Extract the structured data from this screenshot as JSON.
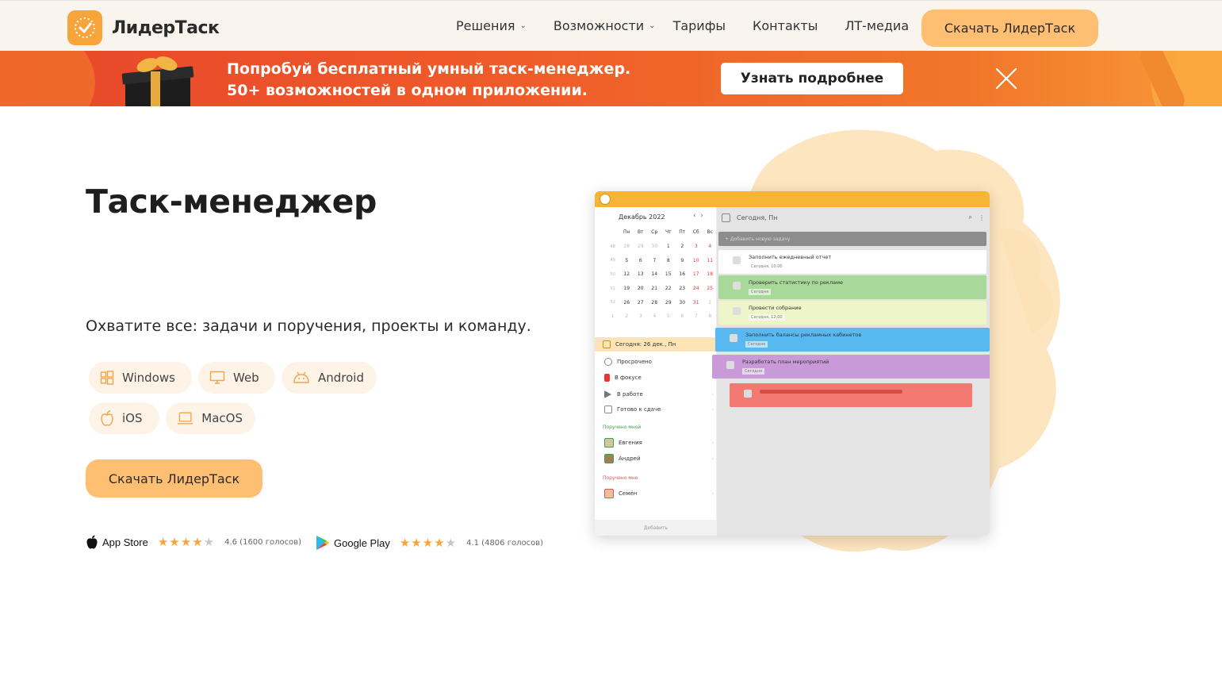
{
  "header": {
    "brand": "ЛидерТаск",
    "nav": [
      {
        "label": "Решения",
        "has_dropdown": true
      },
      {
        "label": "Возможности",
        "has_dropdown": true
      },
      {
        "label": "Тарифы",
        "has_dropdown": false
      },
      {
        "label": "Контакты",
        "has_dropdown": false
      },
      {
        "label": "ЛТ-медиа",
        "has_dropdown": false
      }
    ],
    "cta_label": "Скачать ЛидерТаск"
  },
  "promo": {
    "line1": "Попробуй бесплатный умный таск-менеджер.",
    "line2": "50+ возможностей в одном приложении.",
    "button_label": "Узнать подробнее",
    "close_icon": "close-icon"
  },
  "hero": {
    "title": "Таск-менеджер",
    "subtitle": "Охватите все: задачи и поручения, проекты и команду.",
    "platforms": [
      {
        "label": "Windows",
        "icon": "windows-icon"
      },
      {
        "label": "Web",
        "icon": "monitor-icon"
      },
      {
        "label": "Android",
        "icon": "android-icon"
      },
      {
        "label": "iOS",
        "icon": "apple-icon"
      },
      {
        "label": "MacOS",
        "icon": "laptop-icon"
      }
    ],
    "download_label": "Скачать ЛидерТаск"
  },
  "ratings": [
    {
      "store": "App Store",
      "icon": "apple-icon",
      "stars": 4.6,
      "score_text": "4.6 (1600 голосов)"
    },
    {
      "store": "Google Play",
      "icon": "google-play-icon",
      "stars": 4.1,
      "score_text": "4.1 (4806 голосов)"
    }
  ],
  "app_preview": {
    "calendar_month": "Декабрь 2022",
    "weekdays": [
      "Пн",
      "Вт",
      "Ср",
      "Чт",
      "Пт",
      "Сб",
      "Вс"
    ],
    "weeks": [
      {
        "wk": "48",
        "days": [
          "28",
          "29",
          "30",
          "1",
          "2",
          "3",
          "4"
        ]
      },
      {
        "wk": "49",
        "days": [
          "5",
          "6",
          "7",
          "8",
          "9",
          "10",
          "11"
        ]
      },
      {
        "wk": "50",
        "days": [
          "12",
          "13",
          "14",
          "15",
          "16",
          "17",
          "18"
        ]
      },
      {
        "wk": "51",
        "days": [
          "19",
          "20",
          "21",
          "22",
          "23",
          "24",
          "25"
        ]
      },
      {
        "wk": "52",
        "days": [
          "26",
          "27",
          "28",
          "29",
          "30",
          "31",
          "1"
        ]
      },
      {
        "wk": "1",
        "days": [
          "2",
          "3",
          "4",
          "5",
          "6",
          "7",
          "8"
        ]
      }
    ],
    "today_label": "Сегодня: 26 дек., Пн",
    "side_items": [
      "Просрочено",
      "В фокусе",
      "В работе",
      "Готово к сдаче"
    ],
    "group_assigned_by_me": "Поручено мной",
    "people_by_me": [
      "Евгения",
      "Андрей"
    ],
    "group_assigned_to_me": "Поручено мне",
    "people_to_me": [
      "Семён"
    ],
    "side_footer": "Добавить",
    "main_title": "Сегодня, Пн",
    "add_placeholder": "+ Добавить новую задачу",
    "tasks": [
      {
        "title": "Заполнить ежедневный отчет",
        "meta": "Сегодня, 10:00",
        "color": "#ffffff"
      },
      {
        "title": "Проверить статистику по рекламе",
        "meta": "Сегодня",
        "color": "#a8d99a"
      },
      {
        "title": "Провести собрание",
        "meta": "Сегодня, 12:00",
        "color": "#eef5c8"
      },
      {
        "title": "Заполнить балансы рекламных кабинетов",
        "meta": "Сегодня",
        "color": "#58b8f0"
      },
      {
        "title": "Разработать план мероприятий",
        "meta": "Сегодня",
        "color": "#c99ad8"
      },
      {
        "title": "",
        "meta": "",
        "color": "#f27a72"
      }
    ]
  },
  "colors": {
    "accent": "#ffbf73",
    "brand_orange": "#f7a43a",
    "promo_red": "#e7462a"
  }
}
